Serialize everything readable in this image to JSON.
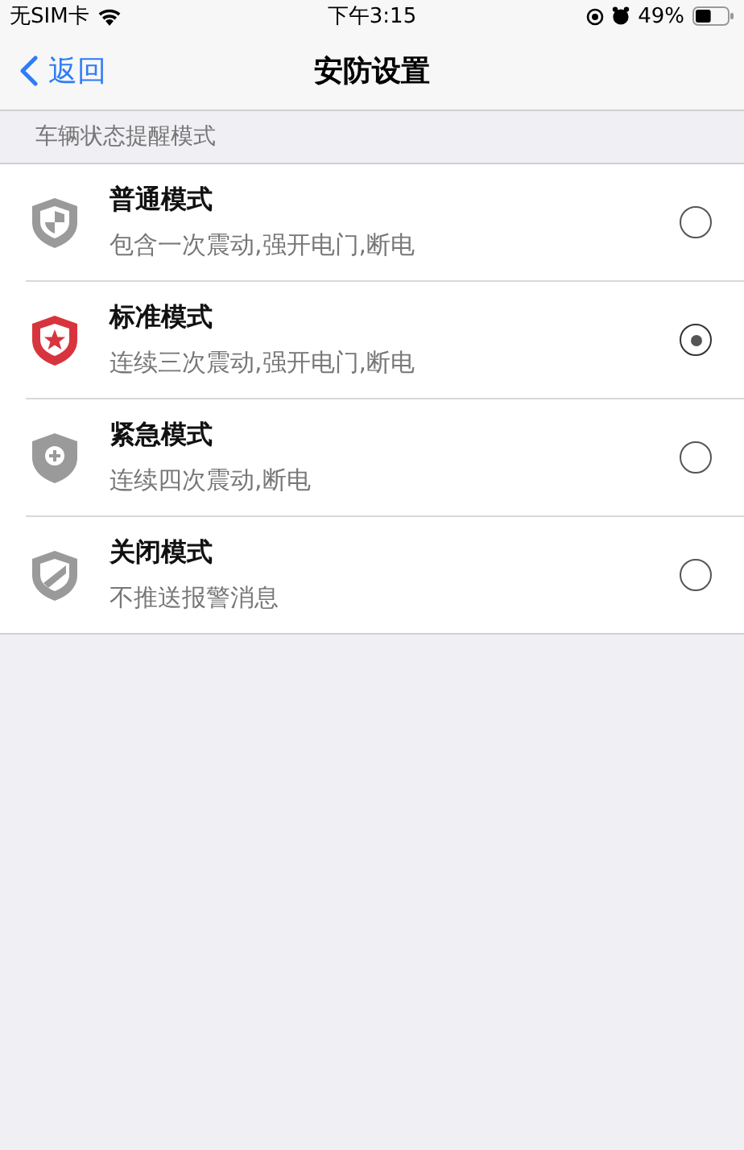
{
  "status_bar": {
    "carrier": "无SIM卡",
    "time": "下午3:15",
    "battery": "49%"
  },
  "nav": {
    "back": "返回",
    "title": "安防设置"
  },
  "section": {
    "header": "车辆状态提醒模式"
  },
  "modes": [
    {
      "kind": "normal",
      "title": "普通模式",
      "description": "包含一次震动,强开电门,断电",
      "selected": false
    },
    {
      "kind": "standard",
      "title": "标准模式",
      "description": "连续三次震动,强开电门,断电",
      "selected": true
    },
    {
      "kind": "emergency",
      "title": "紧急模式",
      "description": "连续四次震动,断电",
      "selected": false
    },
    {
      "kind": "off",
      "title": "关闭模式",
      "description": "不推送报警消息",
      "selected": false
    }
  ]
}
